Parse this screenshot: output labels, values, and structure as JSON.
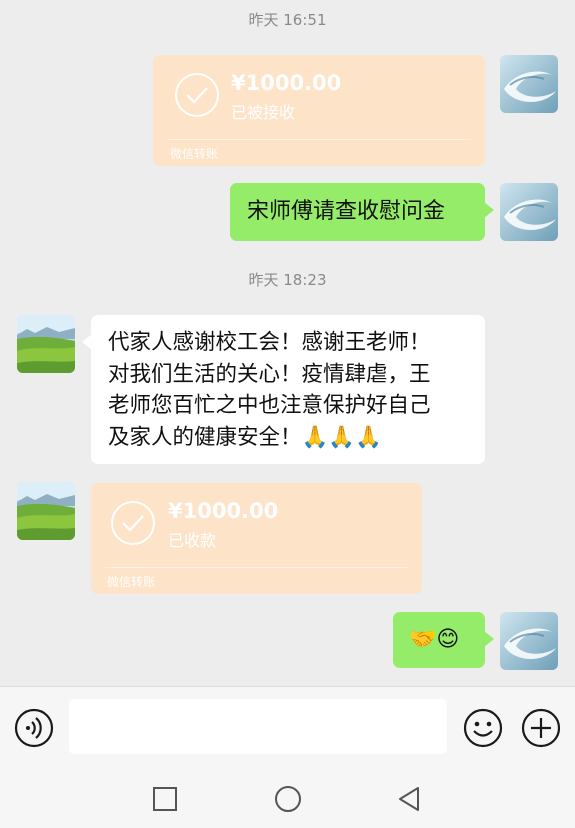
{
  "chat": {
    "timestamp1": "昨天 16:51",
    "timestamp2": "昨天 18:23",
    "transfer_out": {
      "amount": "¥1000.00",
      "status": "已被接收",
      "footer": "微信转账"
    },
    "message_sent_1": "宋师傅请查收慰问金",
    "message_received_1": {
      "line1": "代家人感谢校工会！感谢王老师！",
      "line2": "对我们生活的关心！疫情肆虐，王",
      "line3": "老师您百忙之中也注意保护好自己",
      "line4": "及家人的健康安全！🙏🙏🙏"
    },
    "transfer_in": {
      "amount": "¥1000.00",
      "status": "已收款",
      "footer": "微信转账"
    },
    "message_sent_2": "🤝😊"
  },
  "icons": {
    "voice": "voice-icon",
    "emoji": "emoji-icon",
    "add": "plus-icon",
    "nav_recent": "square-icon",
    "nav_home": "circle-icon",
    "nav_back": "triangle-back-icon"
  },
  "colors": {
    "background": "#ededed",
    "sent_bubble": "#95ec69",
    "received_bubble": "#ffffff",
    "transfer_card": "#fde3c8"
  }
}
